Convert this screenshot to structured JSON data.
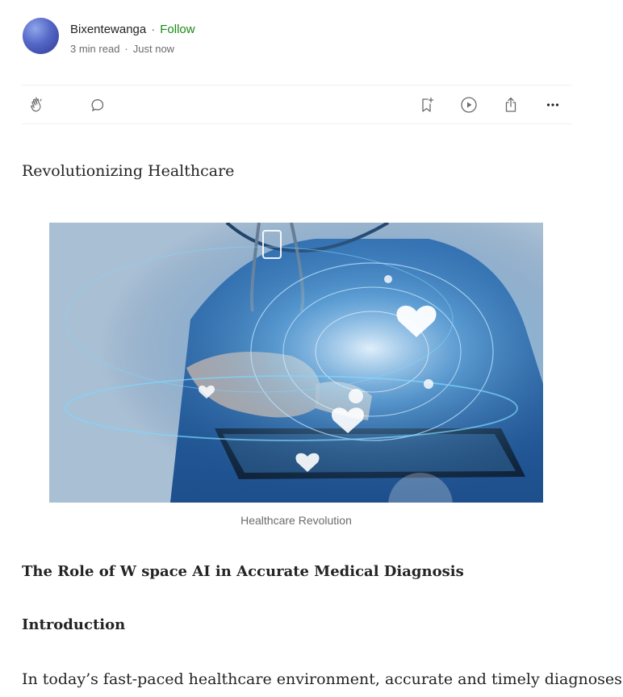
{
  "author": {
    "name": "Bixentewanga",
    "follow_label": "Follow",
    "separator": "·",
    "read_time": "3 min read",
    "published": "Just now"
  },
  "actions": {
    "clap": "clap-icon",
    "comment": "comment-icon",
    "save": "bookmark-add-icon",
    "listen": "play-icon",
    "share": "share-icon",
    "more": "more-icon"
  },
  "article": {
    "subtitle": "Revolutionizing Healthcare",
    "image_caption": "Healthcare Revolution",
    "heading_1": "The Role of W space AI in Accurate Medical Diagnosis",
    "heading_2": "Introduction",
    "paragraph_1": "In today’s fast-paced healthcare environment, accurate and timely diagnoses"
  },
  "colors": {
    "follow": "#1a8917",
    "text": "#242424",
    "muted": "#6b6b6b",
    "divider": "#f0f0f0"
  }
}
